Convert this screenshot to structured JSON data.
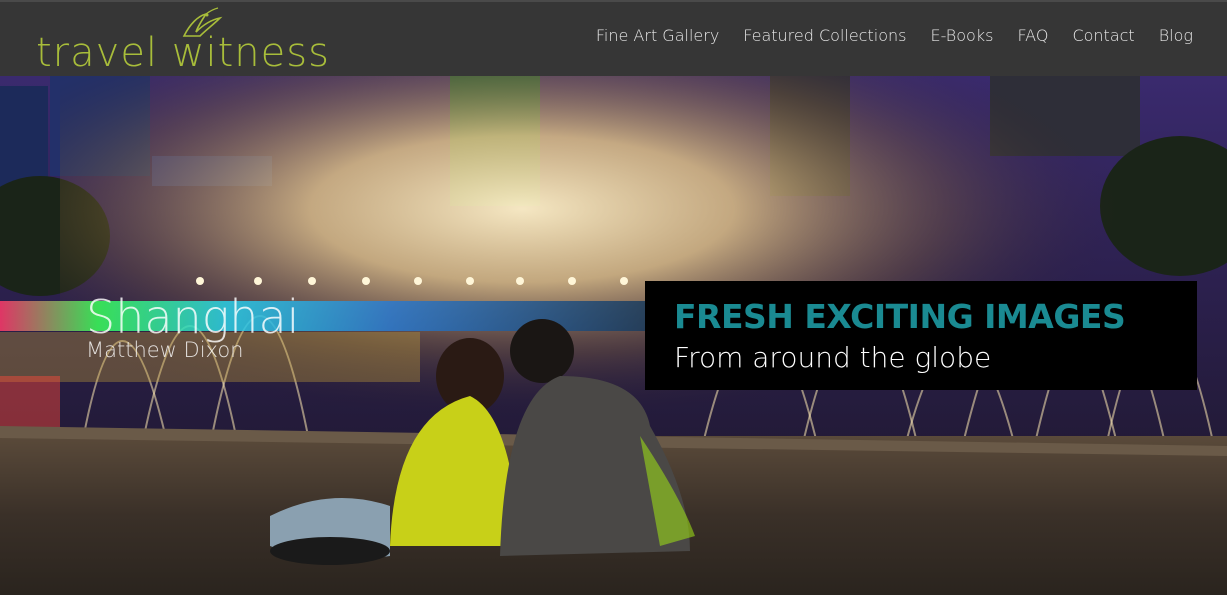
{
  "header": {
    "logo_text": "travel witness",
    "nav": [
      {
        "label": "Fine Art Gallery"
      },
      {
        "label": "Featured Collections"
      },
      {
        "label": "E-Books"
      },
      {
        "label": "FAQ"
      },
      {
        "label": "Contact"
      },
      {
        "label": "Blog"
      }
    ]
  },
  "hero": {
    "caption_title": "Shanghai",
    "caption_author": "Matthew Dixon",
    "promo_headline": "FRESH EXCITING IMAGES",
    "promo_subline": "From around the globe"
  },
  "colors": {
    "header_bg": "#363636",
    "logo_green": "#a8bd3a",
    "promo_bg": "#000000",
    "promo_accent": "#1a8a92"
  }
}
